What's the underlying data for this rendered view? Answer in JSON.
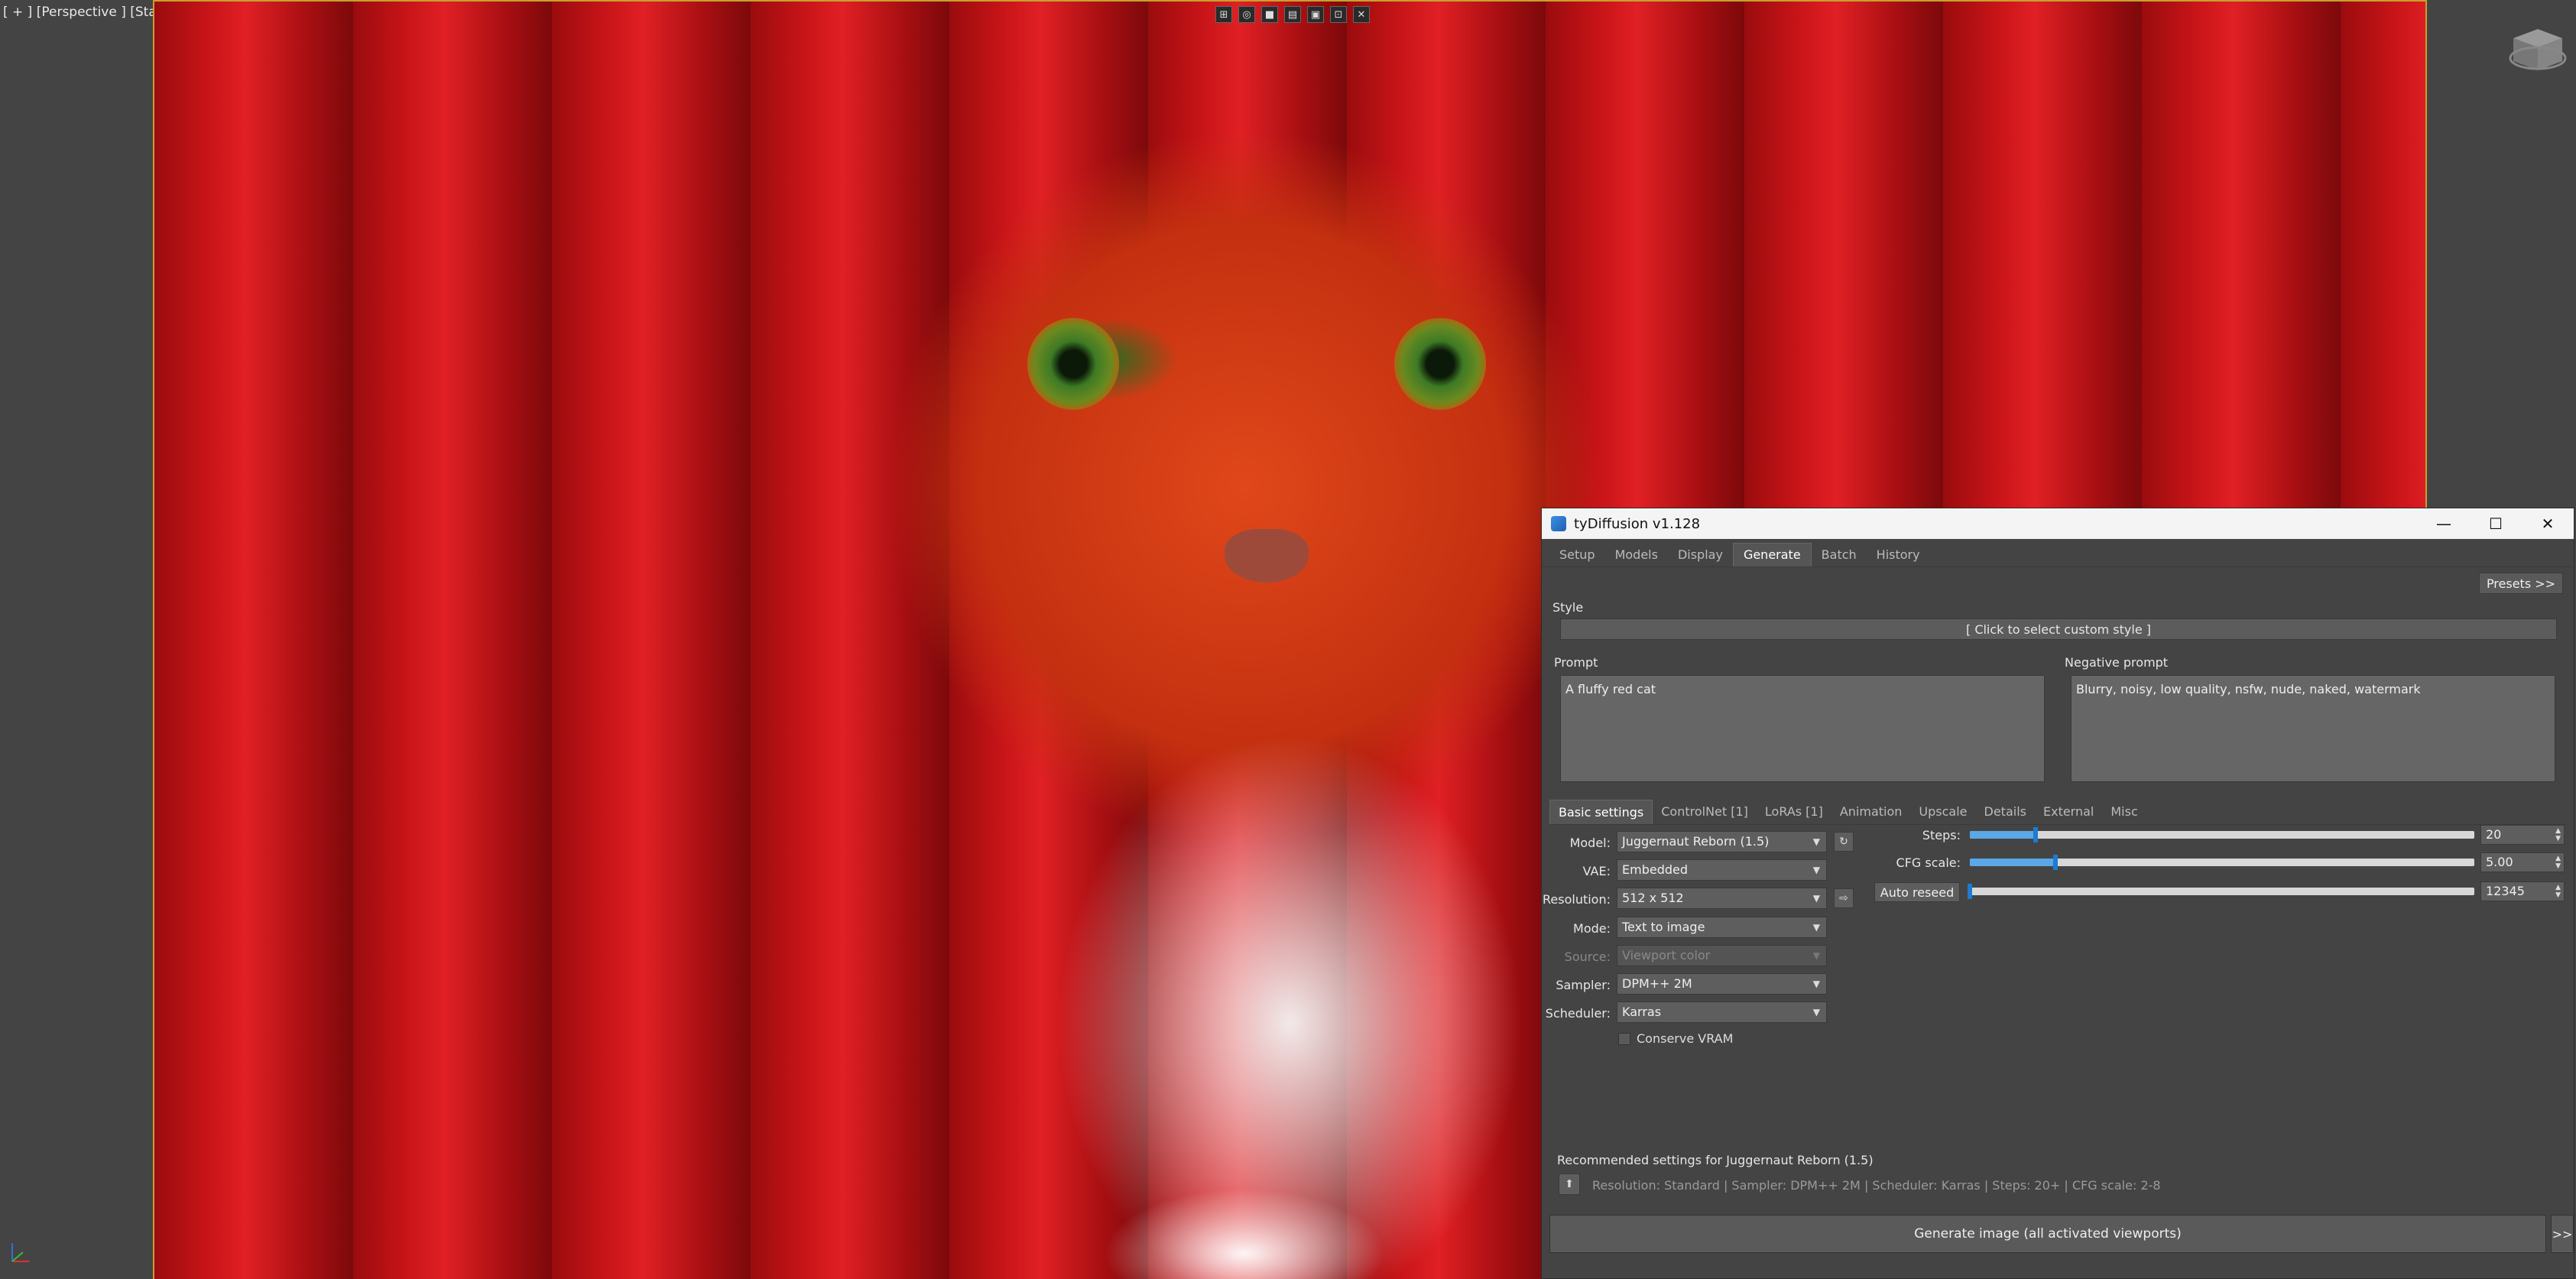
{
  "viewport": {
    "label": "[ + ] [Perspective ] [Standard ] [Default Shading ]",
    "toolbar_icons": [
      "maximize-icon",
      "views-icon",
      "render-icon",
      "frame-icon",
      "screenshot-icon",
      "grid-icon",
      "close-icon"
    ],
    "toolbar_glyphs": [
      "⊞",
      "◎",
      "■",
      "▤",
      "▣",
      "⊡",
      "✕"
    ],
    "frame_color": "#c8a02a"
  },
  "window": {
    "title": "tyDiffusion v1.128",
    "minimize": "—",
    "maximize": "☐",
    "close": "✕"
  },
  "tabs": [
    "Setup",
    "Models",
    "Display",
    "Generate",
    "Batch",
    "History"
  ],
  "active_tab": "Generate",
  "presets_label": "Presets >>",
  "style": {
    "label": "Style",
    "button": "[ Click to select custom style ]"
  },
  "prompt": {
    "label": "Prompt",
    "value": "A fluffy red cat"
  },
  "negative_prompt": {
    "label": "Negative prompt",
    "value": "Blurry, noisy, low quality, nsfw, nude, naked, watermark"
  },
  "subtabs": [
    "Basic settings",
    "ControlNet [1]",
    "LoRAs [1]",
    "Animation",
    "Upscale",
    "Details",
    "External",
    "Misc"
  ],
  "active_subtab": "Basic settings",
  "settings": {
    "model": {
      "label": "Model:",
      "value": "Juggernaut Reborn (1.5)"
    },
    "vae": {
      "label": "VAE:",
      "value": "Embedded"
    },
    "resolution": {
      "label": "Resolution:",
      "value": "512 x 512"
    },
    "mode": {
      "label": "Mode:",
      "value": "Text to image"
    },
    "source": {
      "label": "Source:",
      "value": "Viewport color"
    },
    "sampler": {
      "label": "Sampler:",
      "value": "DPM++ 2M"
    },
    "scheduler": {
      "label": "Scheduler:",
      "value": "Karras"
    },
    "conserve_vram": {
      "label": "Conserve VRAM",
      "checked": false
    }
  },
  "sliders": {
    "steps": {
      "label": "Steps:",
      "value": "20",
      "fraction": 0.13
    },
    "cfg": {
      "label": "CFG scale:",
      "value": "5.00",
      "fraction": 0.17
    },
    "seed": {
      "button": "Auto reseed",
      "value": "12345",
      "fraction": 0.0
    }
  },
  "recommended": {
    "title": "Recommended settings for Juggernaut Reborn (1.5)",
    "line": "Resolution: Standard | Sampler: DPM++ 2M | Scheduler: Karras | Steps: 20+ | CFG scale: 2-8"
  },
  "generate_label": "Generate image (all activated viewports)",
  "more_label": ">>"
}
